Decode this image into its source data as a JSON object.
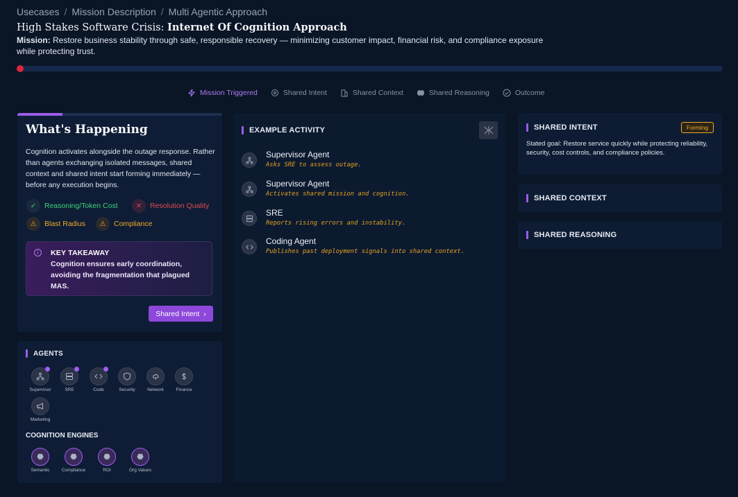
{
  "breadcrumb": {
    "items": [
      "Usecases",
      "Mission Description",
      "Multi Agentic Approach"
    ],
    "separator": "/"
  },
  "header": {
    "title_prefix": "High Stakes Software Crisis: ",
    "title_bold": "Internet Of Cognition Approach",
    "mission_label": "Mission:",
    "mission_text": "Restore business stability through safe, responsible recovery — minimizing customer impact, financial risk, and compliance exposure while protecting trust."
  },
  "progress": {
    "value_percent": 0
  },
  "steps": [
    {
      "label": "Mission Triggered",
      "icon": "bolt-icon",
      "active": true
    },
    {
      "label": "Shared Intent",
      "icon": "target-icon",
      "active": false
    },
    {
      "label": "Shared Context",
      "icon": "building-icon",
      "active": false
    },
    {
      "label": "Shared Reasoning",
      "icon": "brain-icon",
      "active": false
    },
    {
      "label": "Outcome",
      "icon": "check-circle-icon",
      "active": false
    }
  ],
  "happening": {
    "title": "What's Happening",
    "text": "Cognition activates alongside the outage response. Rather than agents exchanging isolated messages, shared context and shared intent start forming immediately — before any execution begins.",
    "metrics": [
      {
        "label": "Reasoning/Token Cost",
        "icon": "check-icon",
        "status": "good"
      },
      {
        "label": "Resolution Quality",
        "icon": "x-icon",
        "status": "bad"
      },
      {
        "label": "Blast Radius",
        "icon": "warning-icon",
        "status": "warn"
      },
      {
        "label": "Compliance",
        "icon": "warning-icon",
        "status": "warn"
      }
    ],
    "takeaway": {
      "title": "KEY TAKEAWAY",
      "text": "Cognition ensures early coordination, avoiding the fragmentation that plagued MAS."
    },
    "next_button": "Shared Intent"
  },
  "agents": {
    "title": "AGENTS",
    "items": [
      {
        "label": "Supervisor",
        "icon": "network-icon",
        "active": true
      },
      {
        "label": "SRE",
        "icon": "server-icon",
        "active": true
      },
      {
        "label": "Code",
        "icon": "code-icon",
        "active": true
      },
      {
        "label": "Security",
        "icon": "shield-icon",
        "active": false
      },
      {
        "label": "Network",
        "icon": "cloud-icon",
        "active": false
      },
      {
        "label": "Finance",
        "icon": "dollar-icon",
        "active": false
      },
      {
        "label": "Marketing",
        "icon": "megaphone-icon",
        "active": false
      }
    ],
    "engines_title": "COGNITION ENGINES",
    "engines": [
      {
        "label": "Semantic",
        "icon": "brain-icon"
      },
      {
        "label": "Compliance",
        "icon": "brain-icon"
      },
      {
        "label": "ROI",
        "icon": "brain-icon"
      },
      {
        "label": "Org Values",
        "icon": "brain-icon"
      }
    ]
  },
  "activity": {
    "title": "EXAMPLE ACTIVITY",
    "items": [
      {
        "name": "Supervisor Agent",
        "desc": "Asks SRE to assess outage.",
        "icon": "network-icon"
      },
      {
        "name": "Supervisor Agent",
        "desc": "Activates shared mission and cognition.",
        "icon": "network-icon"
      },
      {
        "name": "SRE",
        "desc": "Reports rising errors and instability.",
        "icon": "server-icon"
      },
      {
        "name": "Coding Agent",
        "desc": "Publishes past deployment signals into shared context.",
        "icon": "code-icon"
      }
    ]
  },
  "right": {
    "intent": {
      "title": "SHARED INTENT",
      "badge": "Forming",
      "text": "Stated goal: Restore service quickly while protecting reliability, security, cost controls, and compliance policies."
    },
    "context": {
      "title": "SHARED CONTEXT"
    },
    "reasoning": {
      "title": "SHARED REASONING"
    }
  },
  "colors": {
    "background": "#0a1526",
    "accent": "#9c5ce8",
    "good": "#3ed27a",
    "bad": "#e04a4a",
    "warn": "#f0a928"
  }
}
